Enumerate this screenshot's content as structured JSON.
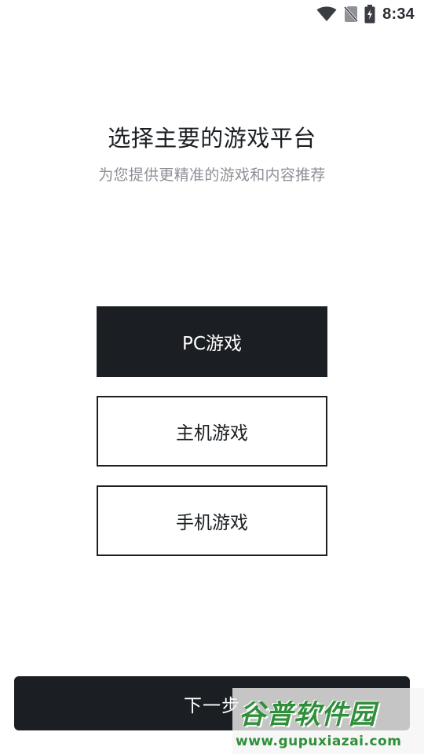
{
  "status_bar": {
    "time": "8:34",
    "icons": [
      "wifi-icon",
      "no-sim-icon",
      "battery-charging-icon"
    ]
  },
  "header": {
    "title": "选择主要的游戏平台",
    "subtitle": "为您提供更精准的游戏和内容推荐"
  },
  "options": [
    {
      "label": "PC游戏",
      "selected": true
    },
    {
      "label": "主机游戏",
      "selected": false
    },
    {
      "label": "手机游戏",
      "selected": false
    }
  ],
  "footer": {
    "next_label": "下一步"
  },
  "watermark": {
    "text": "谷普软件园",
    "url": "www.gupuxiazai.com"
  },
  "colors": {
    "primary": "#1b1f23",
    "subtitle": "#8c9096",
    "background": "#ffffff",
    "watermark": "#2f8f3a"
  }
}
